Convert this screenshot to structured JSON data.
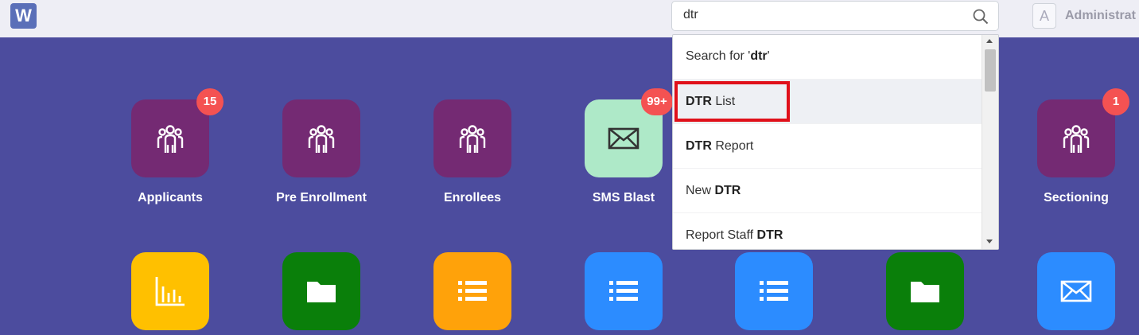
{
  "header": {
    "logo_letter": "W",
    "search": {
      "value": "dtr",
      "placeholder": ""
    },
    "user": {
      "avatar_letter": "A",
      "name": "Administrat"
    }
  },
  "search_results": [
    {
      "prefix": "Search for '",
      "bold": "dtr",
      "suffix": "'"
    },
    {
      "prefix": "",
      "bold": "DTR",
      "suffix": " List"
    },
    {
      "prefix": "",
      "bold": "DTR",
      "suffix": " Report"
    },
    {
      "prefix": "New ",
      "bold": "DTR",
      "suffix": ""
    },
    {
      "prefix": "Report Staff ",
      "bold": "DTR",
      "suffix": ""
    }
  ],
  "tiles_row1": [
    {
      "label": "Applicants",
      "badge": "15",
      "icon": "users-icon",
      "color": "#742a73"
    },
    {
      "label": "Pre Enrollment",
      "badge": "",
      "icon": "users-icon",
      "color": "#742a73"
    },
    {
      "label": "Enrollees",
      "badge": "",
      "icon": "users-icon",
      "color": "#742a73"
    },
    {
      "label": "SMS Blast",
      "badge": "99+",
      "icon": "envelope-icon",
      "color": "#aee9c8"
    },
    {
      "label": "Sectioning",
      "badge": "1",
      "icon": "users-icon",
      "color": "#742a73"
    }
  ],
  "tiles_row2": [
    {
      "icon": "bar-chart-icon",
      "color": "#ffc000"
    },
    {
      "icon": "folder-icon",
      "color": "#0a7f0a"
    },
    {
      "icon": "list-icon",
      "color": "#ffa20a"
    },
    {
      "icon": "list-icon",
      "color": "#2c8cff"
    },
    {
      "icon": "list-icon",
      "color": "#2c8cff"
    },
    {
      "icon": "folder-icon",
      "color": "#0a7f0a"
    },
    {
      "icon": "envelope-icon",
      "color": "#2c8cff"
    }
  ],
  "colors": {
    "background": "#4c4c9e",
    "highlight_box": "#e0101a",
    "badge": "#f45252"
  }
}
